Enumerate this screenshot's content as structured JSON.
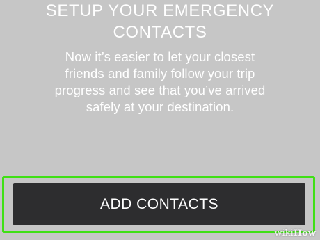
{
  "title": {
    "line1": "SETUP YOUR EMERGENCY",
    "line2": "CONTACTS"
  },
  "description": {
    "line1": "Now it’s easier to let your closest",
    "line2": "friends and family follow your trip",
    "line3": "progress and see that you’ve arrived",
    "line4": "safely at your destination."
  },
  "actions": {
    "add_contacts_label": "ADD CONTACTS"
  },
  "watermark": {
    "wiki": "wiki",
    "how": "How"
  },
  "colors": {
    "background": "#c6c6c6",
    "button": "#2d2d2f",
    "highlight": "#3fe014",
    "text": "#ffffff"
  }
}
